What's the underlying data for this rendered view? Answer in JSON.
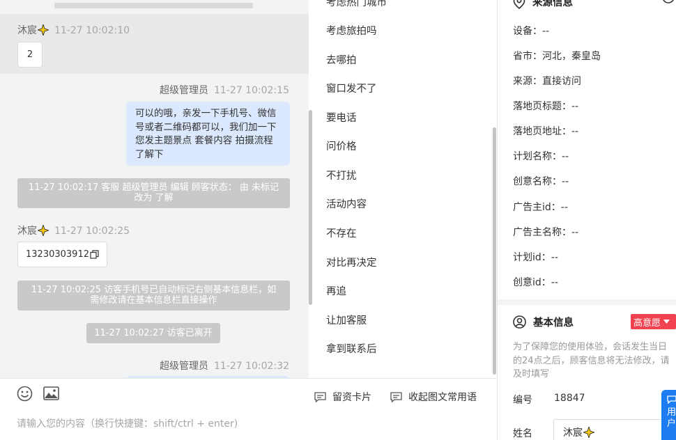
{
  "chat": {
    "messages": [
      {
        "sender": "沐宸",
        "time": "11-27 10:02:10",
        "text": "2"
      },
      {
        "sender": "超级管理员",
        "time": "11-27 10:02:15",
        "text": "可以的哦，亲发一下手机号、微信号或者二维码都可以，我们加一下您发主题景点 套餐内容 拍摄流程了解下"
      },
      {
        "sender": "沐宸",
        "time": "11-27 10:02:25",
        "text": "13230303912"
      },
      {
        "sender": "超级管理员",
        "time": "11-27 10:02:32"
      }
    ],
    "system": [
      "11-27 10:02:17 客服 超级管理员 编辑 顾客状态： 由 未标记 改为 了解",
      "11-27 10:02:25 访客手机号已自动标记右侧基本信息栏，如需修改请在基本信息栏直接操作",
      "11-27 10:02:27 访客已离开"
    ]
  },
  "phrases": {
    "items": [
      "考虑热门城市",
      "考虑旅拍吗",
      "去哪拍",
      "窗口发不了",
      "要电话",
      "问价格",
      "不打扰",
      "活动内容",
      "不存在",
      "对比再决定",
      "再追",
      "让加客服",
      "拿到联系后"
    ]
  },
  "toolbar": {
    "card_label": "留资卡片",
    "phrases_label": "收起图文常用语",
    "placeholder": "请输入您的内容（换行快捷键：shift/ctrl + enter)"
  },
  "source_info": {
    "title": "来源信息",
    "fields": [
      "设备：--",
      "省市：河北，秦皇岛",
      "来源：直接访问",
      "落地页标题：--",
      "落地页地址：--",
      "计划名称：--",
      "创意名称：--",
      "广告主id：--",
      "广告主名称：--",
      "计划id：--",
      "创意id：--"
    ]
  },
  "basic_info": {
    "title": "基本信息",
    "intent_badge": "高意愿",
    "notice": "为了保障您的使用体验，会话发生当日的24点之后，顾客信息将无法修改，请及时填写",
    "id_label": "编号",
    "id_value": "18847",
    "name_label": "姓名",
    "name_value": "沐宸"
  },
  "float_button": {
    "label": "用户"
  },
  "colors": {
    "agent_bubble": "#dbe8fd",
    "system_bar": "#c9c9c9",
    "badge": "#f2414f",
    "float_button": "#1e7cf2"
  }
}
